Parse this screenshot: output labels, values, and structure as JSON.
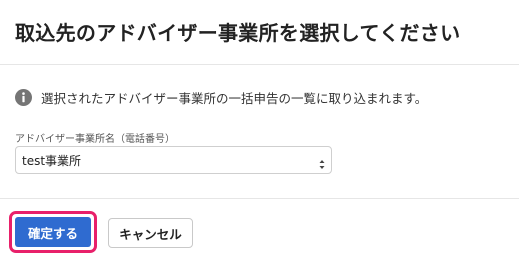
{
  "dialog": {
    "title": "取込先のアドバイザー事業所を選択してください",
    "info": {
      "icon": "info-icon",
      "text": "選択されたアドバイザー事業所の一括申告の一覧に取り込まれます。"
    },
    "field": {
      "label": "アドバイザー事業所名（電話番号）",
      "selected_value": "test事業所"
    },
    "buttons": {
      "confirm_label": "確定する",
      "cancel_label": "キャンセル"
    },
    "colors": {
      "primary": "#2f6bd0",
      "highlight": "#e8206a",
      "info_icon": "#757575"
    }
  }
}
